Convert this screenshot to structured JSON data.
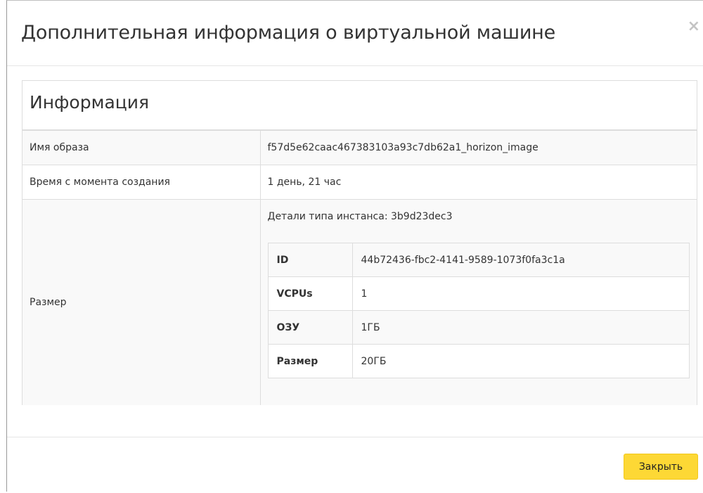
{
  "modal": {
    "title": "Дополнительная информация о виртуальной машине",
    "close_glyph": "×"
  },
  "panel": {
    "title": "Информация",
    "rows": {
      "image_label": "Имя образа",
      "image_value": "f57d5e62caac467383103a93c7db62a1_horizon_image",
      "time_label": "Время с момента создания",
      "time_value": "1 день, 21 час",
      "size_label": "Размер",
      "flavor_caption": "Детали типа инстанса: 3b9d23dec3"
    }
  },
  "flavor": [
    {
      "key": "ID",
      "value": "44b72436-fbc2-4141-9589-1073f0fa3c1a"
    },
    {
      "key": "VCPUs",
      "value": "1"
    },
    {
      "key": "ОЗУ",
      "value": "1ГБ"
    },
    {
      "key": "Размер",
      "value": "20ГБ"
    }
  ],
  "footer": {
    "close_label": "Закрыть"
  },
  "colors": {
    "button_bg": "#fdd835",
    "border": "#dddddd",
    "stripe": "#f9f9f9"
  }
}
